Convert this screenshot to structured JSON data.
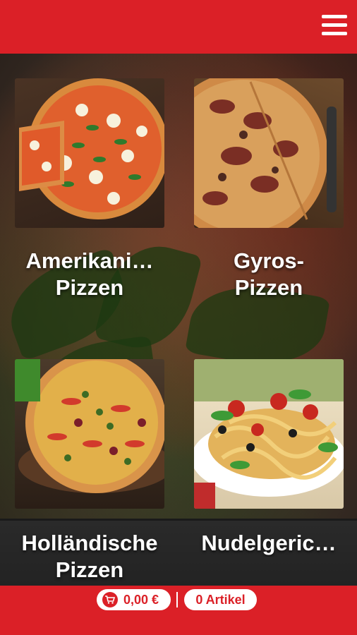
{
  "header": {
    "menu_icon": "hamburger-menu-icon",
    "accent": "#db2027"
  },
  "categories": [
    {
      "line1": "Amerikani…",
      "line2": "Pizzen"
    },
    {
      "line1": "Gyros-",
      "line2": "Pizzen"
    },
    {
      "line1": "Holländische",
      "line2": "Pizzen"
    },
    {
      "line1": "Nudelgeric…",
      "line2": ""
    }
  ],
  "footer": {
    "cart_icon": "cart-icon",
    "price": "0,00 €",
    "items": "0 Artikel"
  }
}
